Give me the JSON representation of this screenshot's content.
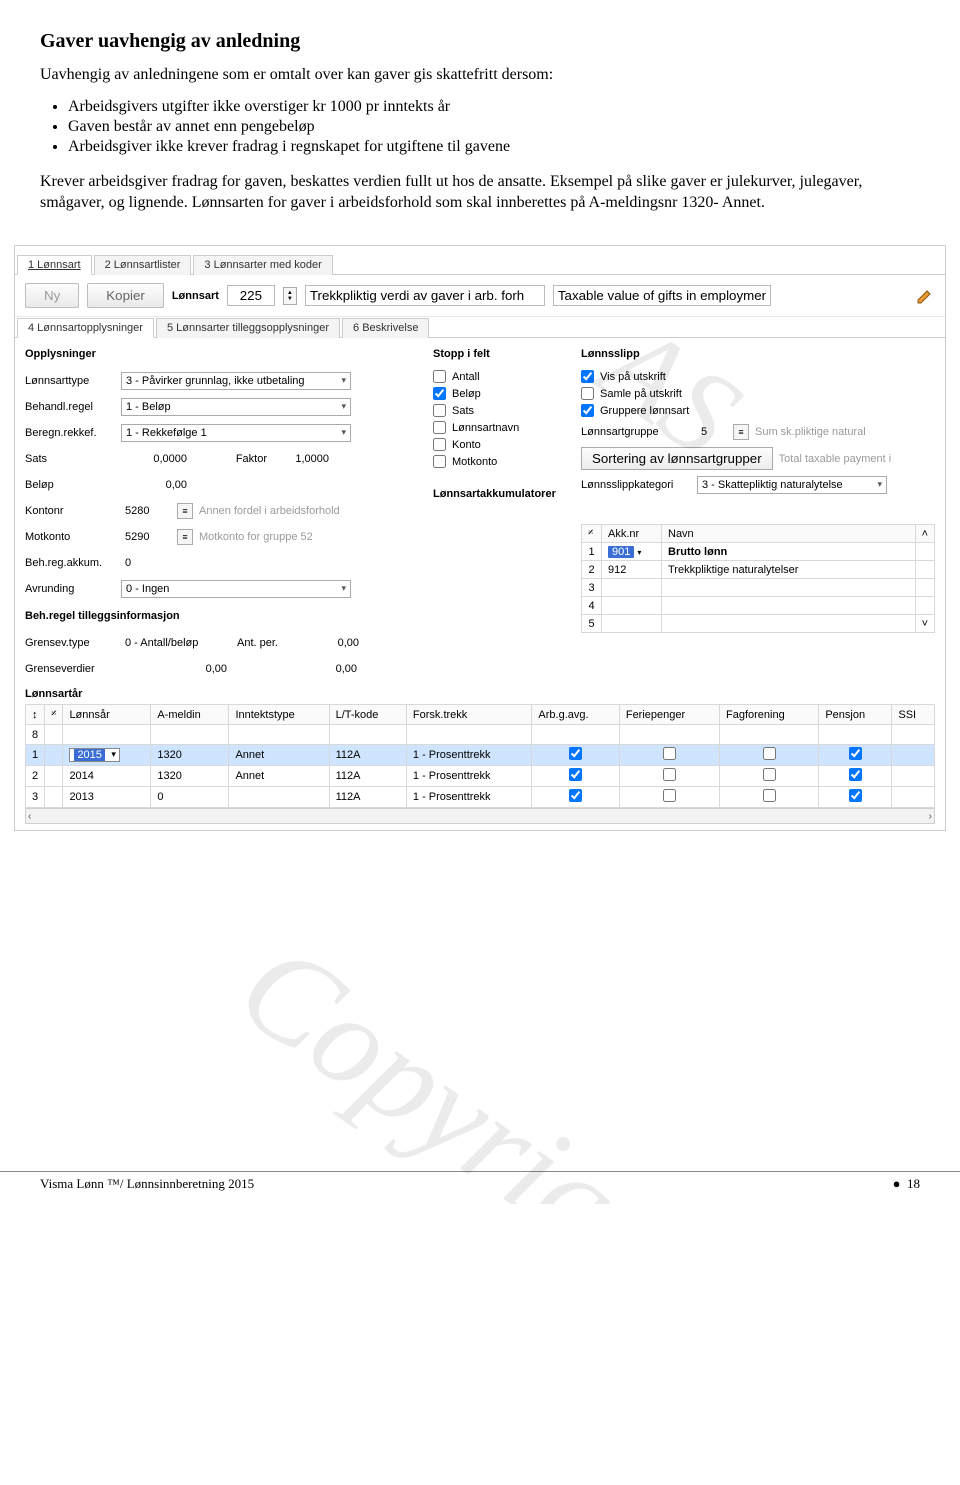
{
  "doc": {
    "heading": "Gaver uavhengig av anledning",
    "intro": "Uavhengig av anledningene som er omtalt over kan gaver gis skattefritt dersom:",
    "bullets": [
      "Arbeidsgivers utgifter ikke overstiger kr 1000 pr inntekts år",
      "Gaven består av annet enn pengebeløp",
      "Arbeidsgiver ikke krever fradrag i regnskapet for utgiftene til gavene"
    ],
    "p2": "Krever arbeidsgiver fradrag for gaven, beskattes verdien fullt ut hos de ansatte. Eksempel på slike gaver er julekurver, julegaver, smågaver, og lignende. Lønnsarten for gaver i arbeidsforhold som skal innberettes på A-meldingsnr 1320- Annet."
  },
  "watermark_top": "AS",
  "watermark_bottom": "Copyrig",
  "top_tabs": [
    "1 Lønnsart",
    "2 Lønnsartlister",
    "3 Lønnsarter med koder"
  ],
  "toolbar": {
    "ny": "Ny",
    "kopier": "Kopier",
    "lonnsart_label": "Lønnsart",
    "lonnsart_nr": "225",
    "lonnsart_desc": "Trekkpliktig verdi av gaver i arb. forh",
    "lonnsart_desc_en": "Taxable value of gifts in employment"
  },
  "second_tabs": [
    "4 Lønnsartopplysninger",
    "5 Lønnsarter tilleggsopplysninger",
    "6 Beskrivelse"
  ],
  "form": {
    "section_opplysninger": "Opplysninger",
    "section_stopp": "Stopp i felt",
    "section_lonnsslipp": "Lønnsslipp",
    "lonnsarttype_label": "Lønnsarttype",
    "lonnsarttype_val": "3 - Påvirker grunnlag, ikke utbetaling",
    "behandlregel_label": "Behandl.regel",
    "behandlregel_val": "1 - Beløp",
    "beregnrekkef_label": "Beregn.rekkef.",
    "beregnrekkef_val": "1 - Rekkefølge 1",
    "sats_label": "Sats",
    "sats_val": "0,0000",
    "faktor_label": "Faktor",
    "faktor_val": "1,0000",
    "belop_label": "Beløp",
    "belop_val": "0,00",
    "kontonr_label": "Kontonr",
    "kontonr_val": "5280",
    "kontonr_hint": "Annen fordel i arbeidsforhold",
    "motkonto_label": "Motkonto",
    "motkonto_val": "5290",
    "motkonto_hint": "Motkonto for gruppe 52",
    "behregakkum_label": "Beh.reg.akkum.",
    "behregakkum_val": "0",
    "avrunding_label": "Avrunding",
    "avrunding_val": "0 - Ingen",
    "tillegg_heading": "Beh.regel tilleggsinformasjon",
    "grensevtype_label": "Grensev.type",
    "grensevtype_val": "0 - Antall/beløp",
    "antper_label": "Ant. per.",
    "antper_val": "0,00",
    "grenseverdier_label": "Grenseverdier",
    "grenseverdier_v1": "0,00",
    "grenseverdier_v2": "0,00",
    "stopp": {
      "antall": "Antall",
      "belop": "Beløp",
      "sats": "Sats",
      "lonnsartnavn": "Lønnsartnavn",
      "konto": "Konto",
      "motkonto": "Motkonto"
    },
    "slip": {
      "vis": "Vis på utskrift",
      "samle": "Samle på utskrift",
      "grupper": "Gruppere lønnsart",
      "lonnsartgruppe_label": "Lønnsartgruppe",
      "lonnsartgruppe_val": "5",
      "lonnsartgruppe_hint": "Sum sk.pliktige natural",
      "sortbtn": "Sortering av lønnsartgrupper",
      "sorthint": "Total taxable payment i",
      "kategori_label": "Lønnsslippkategori",
      "kategori_val": "3 - Skattepliktig naturalytelse"
    },
    "akkum_heading": "Lønnsartakkumulatorer",
    "akkum_cols": {
      "akknr": "Akk.nr",
      "navn": "Navn"
    },
    "akkum_rows": [
      {
        "n": "1",
        "akknr": "901",
        "navn": "Brutto lønn",
        "sel": true
      },
      {
        "n": "2",
        "akknr": "912",
        "navn": "Trekkpliktige naturalytelser"
      },
      {
        "n": "3"
      },
      {
        "n": "4"
      },
      {
        "n": "5"
      }
    ]
  },
  "years_heading": "Lønnsartår",
  "years_cols": [
    "",
    "",
    "Lønnsår",
    "A-meldin",
    "Inntektstype",
    "L/T-kode",
    "Forsk.trekk",
    "Arb.g.avg.",
    "Feriepenger",
    "Fagforening",
    "Pensjon",
    "SSI"
  ],
  "years_rows": [
    {
      "n": "8"
    },
    {
      "n": "1",
      "year": "2015",
      "ameld": "1320",
      "itype": "Annet",
      "lt": "112A",
      "ft": "1 - Prosenttrekk",
      "aga": true,
      "ferie": false,
      "fag": false,
      "pensjon": true,
      "sel": true
    },
    {
      "n": "2",
      "year": "2014",
      "ameld": "1320",
      "itype": "Annet",
      "lt": "112A",
      "ft": "1 - Prosenttrekk",
      "aga": true,
      "ferie": false,
      "fag": false,
      "pensjon": true
    },
    {
      "n": "3",
      "year": "2013",
      "ameld": "0",
      "itype": "",
      "lt": "112A",
      "ft": "1 - Prosenttrekk",
      "aga": true,
      "ferie": false,
      "fag": false,
      "pensjon": true
    }
  ],
  "footer": {
    "left": "Visma Lønn ™/ Lønnsinnberetning 2015",
    "bullet": "●",
    "right": "18"
  }
}
